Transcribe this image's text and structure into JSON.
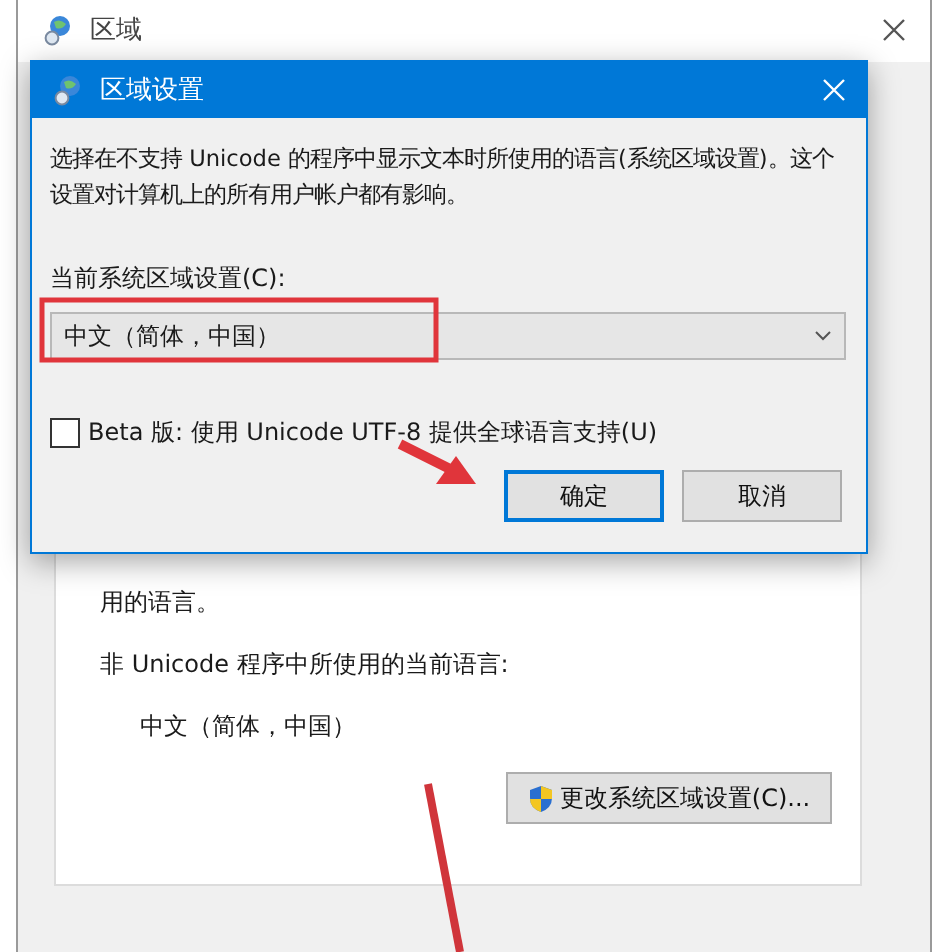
{
  "background_window": {
    "title": "区域",
    "partial_text": "用的语言。",
    "current_language_label": "非 Unicode 程序中所使用的当前语言:",
    "current_language": "中文（简体，中国）",
    "change_button": "更改系统区域设置(C)..."
  },
  "dialog": {
    "title": "区域设置",
    "description": "选择在不支持 Unicode 的程序中显示文本时所使用的语言(系统区域设置)。这个设置对计算机上的所有用户帐户都有影响。",
    "locale_label": "当前系统区域设置(C):",
    "locale_select": {
      "value": "中文（简体，中国）"
    },
    "beta_option": {
      "label": "Beta 版: 使用 Unicode UTF-8 提供全球语言支持(U)",
      "checked": false
    },
    "buttons": [
      {
        "label": "确定",
        "focused": true
      },
      {
        "label": "取消",
        "focused": false
      }
    ]
  }
}
